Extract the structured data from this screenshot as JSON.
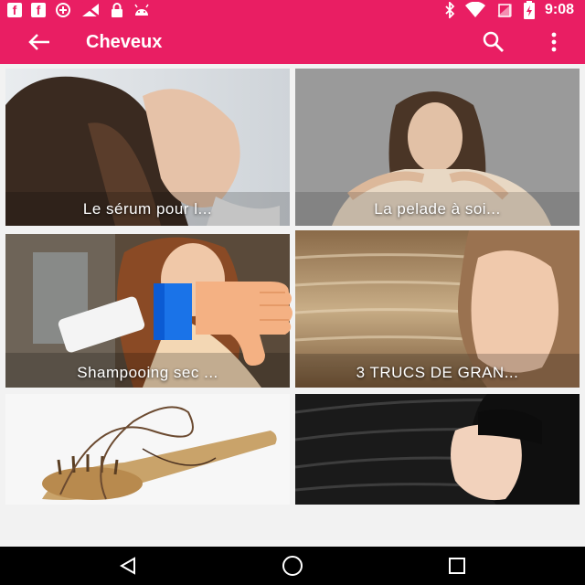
{
  "status_bar": {
    "time": "9:08",
    "left_icons": [
      "facebook-icon",
      "facebook-icon",
      "data-saver-icon",
      "no-signal-icon",
      "lock-icon",
      "android-icon"
    ],
    "right_icons": [
      "bluetooth-icon",
      "wifi-icon",
      "no-sim-icon",
      "battery-icon"
    ]
  },
  "app_bar": {
    "title": "Cheveux",
    "back_icon": "arrow-back-icon",
    "search_icon": "search-icon",
    "menu_icon": "more-vert-icon",
    "color": "#e91e63"
  },
  "articles": [
    {
      "caption": "Le sérum pour l..."
    },
    {
      "caption": "La pelade à soi..."
    },
    {
      "caption": "Shampooing sec ..."
    },
    {
      "caption": "3 TRUCS DE GRAN..."
    },
    {
      "caption": ""
    },
    {
      "caption": ""
    }
  ],
  "overlay": {
    "icon": "thumbs-down-icon"
  },
  "nav_bar": {
    "icons": [
      "back-triangle-icon",
      "home-circle-icon",
      "recents-square-icon"
    ]
  }
}
